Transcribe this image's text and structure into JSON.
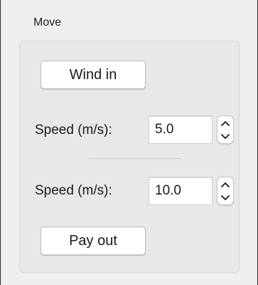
{
  "group": {
    "title": "Move"
  },
  "wind_in": {
    "label": "Wind in"
  },
  "speed_wind": {
    "label": "Speed (m/s):",
    "value": "5.0"
  },
  "speed_pay": {
    "label": "Speed (m/s):",
    "value": "10.0"
  },
  "pay_out": {
    "label": "Pay out"
  },
  "icons": {
    "stepper_up": "chevron-up-icon",
    "stepper_down": "chevron-down-icon"
  },
  "colors": {
    "panel_background": "#efefef",
    "group_background": "#e8e8e8",
    "field_background": "#ffffff"
  }
}
